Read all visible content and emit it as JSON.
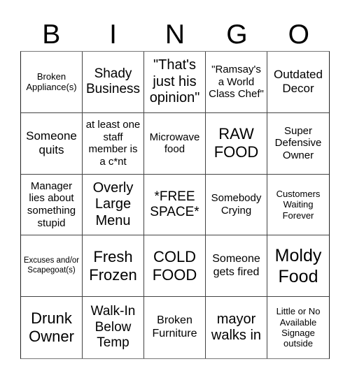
{
  "header": {
    "letters": [
      "B",
      "I",
      "N",
      "G",
      "O"
    ]
  },
  "board": {
    "rows": [
      [
        "Broken Appliance(s)",
        "Shady Business",
        "\"That's just his opinion\"",
        "\"Ramsay's a World Class Chef\"",
        "Outdated Decor"
      ],
      [
        "Someone quits",
        "at least one staff member is a c*nt",
        "Microwave food",
        "RAW FOOD",
        "Super Defensive Owner"
      ],
      [
        "Manager lies about something stupid",
        "Overly Large Menu",
        "*FREE SPACE*",
        "Somebody Crying",
        "Customers Waiting Forever"
      ],
      [
        "Excuses and/or Scapegoat(s)",
        "Fresh Frozen",
        "COLD FOOD",
        "Someone gets fired",
        "Moldy Food"
      ],
      [
        "Drunk Owner",
        "Walk-In Below Temp",
        "Broken Furniture",
        "mayor walks in",
        "Little or No Available Signage outside"
      ]
    ],
    "free_space": "*FREE SPACE*"
  }
}
